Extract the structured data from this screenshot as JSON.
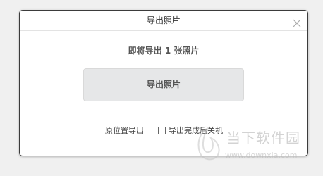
{
  "dialog": {
    "title": "导出照片",
    "message": "即将导出 1 张照片",
    "export_button_label": "导出照片",
    "options": [
      {
        "label": "原位置导出",
        "checked": false
      },
      {
        "label": "导出完成后关机",
        "checked": false
      }
    ]
  },
  "watermark": {
    "brand": "当下软件园",
    "url": "www.downxia.com"
  }
}
